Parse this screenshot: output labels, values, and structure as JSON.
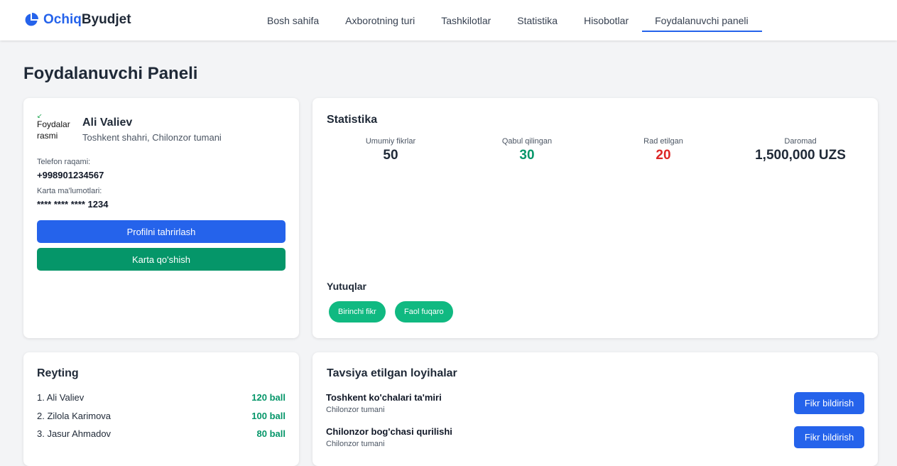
{
  "header": {
    "logo_part1": "Ochiq",
    "logo_part2": "Byudjet",
    "logo_icon": "pie-chart-icon",
    "nav": [
      {
        "label": "Bosh sahifa"
      },
      {
        "label": "Axborotning turi"
      },
      {
        "label": "Tashkilotlar"
      },
      {
        "label": "Statistika"
      },
      {
        "label": "Hisobotlar"
      },
      {
        "label": "Foydalanuvchi paneli",
        "active": true
      }
    ]
  },
  "page": {
    "title": "Foydalanuvchi Paneli"
  },
  "profile": {
    "avatar_alt_line1": "Foydalar",
    "avatar_alt_line2": "rasmi",
    "name": "Ali Valiev",
    "location": "Toshkent shahri, Chilonzor tumani",
    "phone_label": "Telefon raqami:",
    "phone_value": "+998901234567",
    "card_label": "Karta ma'lumotlari:",
    "card_value": "**** **** **** 1234",
    "edit_button": "Profilni tahrirlash",
    "add_card_button": "Karta qo'shish"
  },
  "statistics": {
    "title": "Statistika",
    "items": [
      {
        "label": "Umumiy fikrlar",
        "value": "50"
      },
      {
        "label": "Qabul qilingan",
        "value": "30"
      },
      {
        "label": "Rad etilgan",
        "value": "20"
      },
      {
        "label": "Daromad",
        "value": "1,500,000 UZS"
      }
    ],
    "achievements_title": "Yutuqlar",
    "achievements": [
      "Birinchi fikr",
      "Faol fuqaro"
    ]
  },
  "rating": {
    "title": "Reyting",
    "rows": [
      {
        "name": "1. Ali Valiev",
        "points": "120 ball"
      },
      {
        "name": "2. Zilola Karimova",
        "points": "100 ball"
      },
      {
        "name": "3. Jasur Ahmadov",
        "points": "80 ball"
      }
    ]
  },
  "projects": {
    "title": "Tavsiya etilgan loyihalar",
    "items": [
      {
        "title": "Toshkent ko'chalari ta'miri",
        "district": "Chilonzor tumani",
        "button": "Fikr bildirish"
      },
      {
        "title": "Chilonzor bog'chasi qurilishi",
        "district": "Chilonzor tumani",
        "button": "Fikr bildirish"
      }
    ]
  },
  "colors": {
    "primary": "#2563eb",
    "accent_green": "#059669",
    "badge_green": "#10b981",
    "reject_red": "#dc2626",
    "text_dark": "#1f2937",
    "background": "#f3f4f6"
  }
}
